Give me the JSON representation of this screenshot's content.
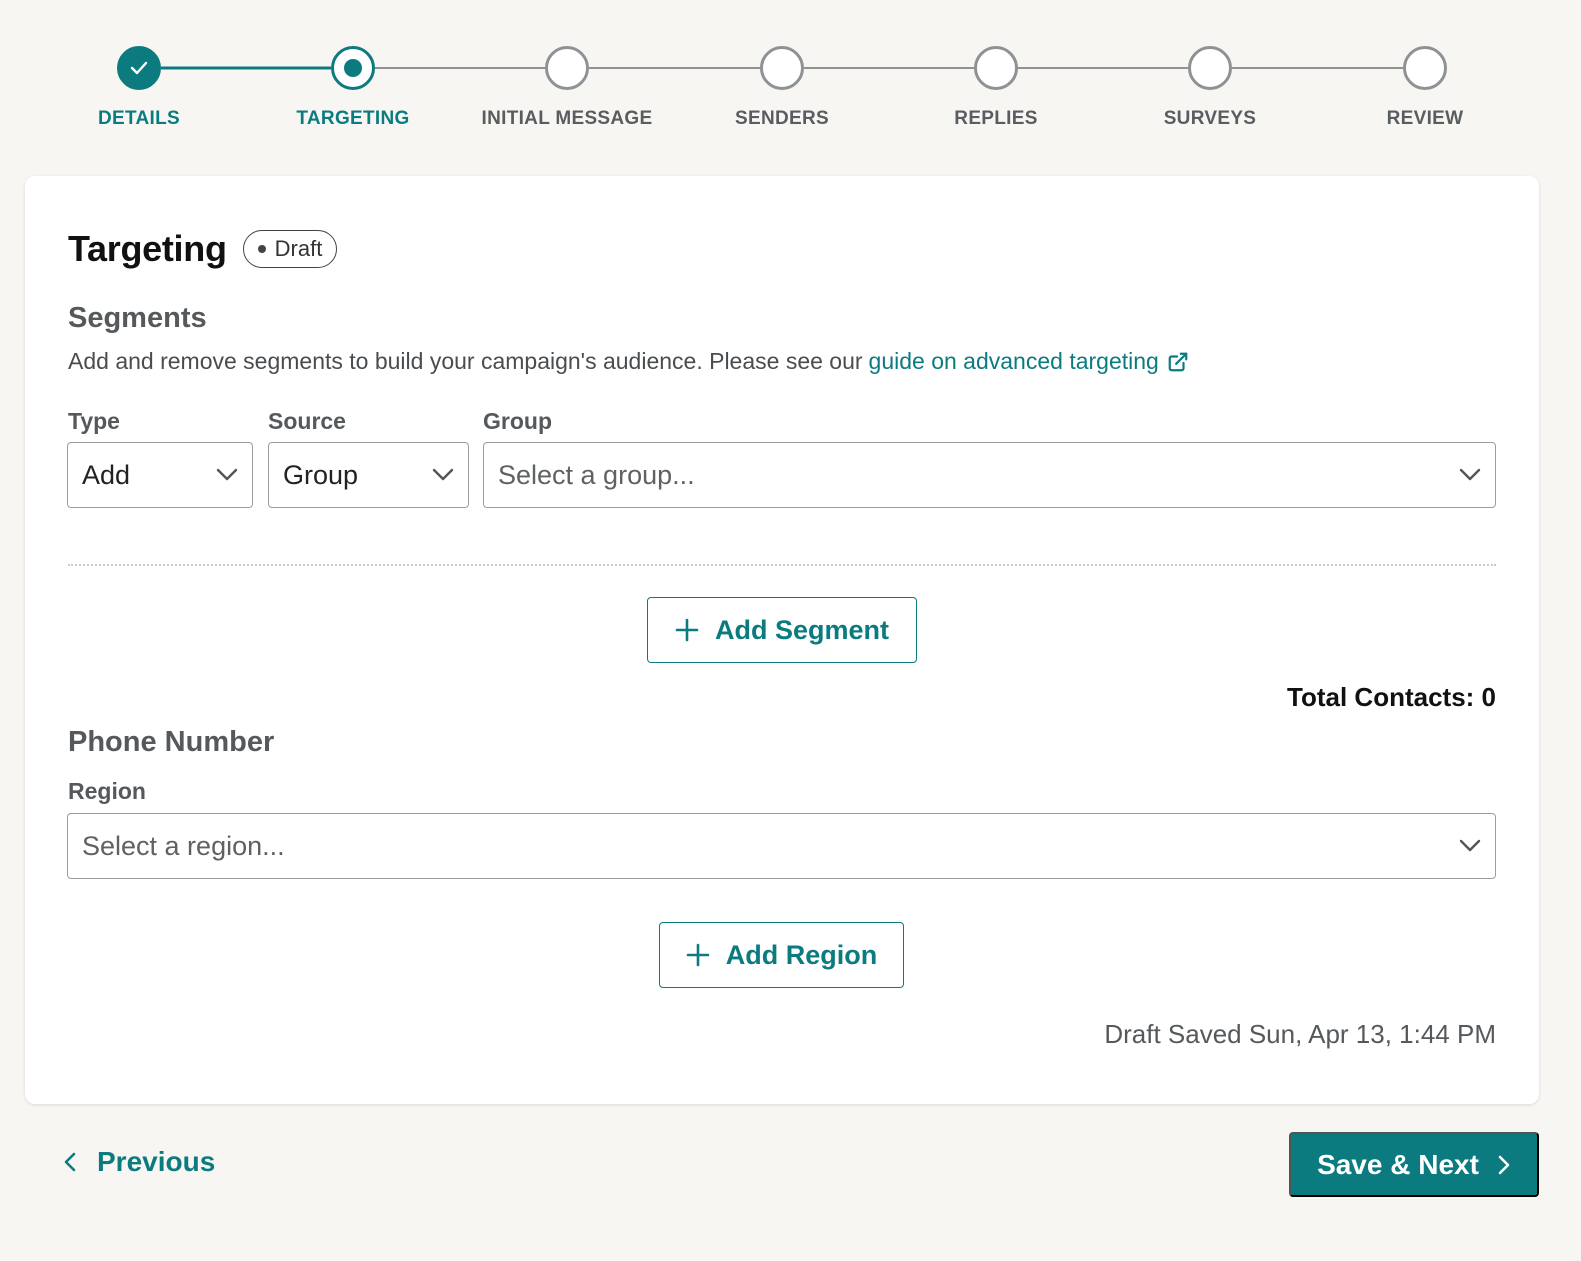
{
  "stepper": {
    "steps": [
      {
        "label": "DETAILS",
        "state": "done"
      },
      {
        "label": "TARGETING",
        "state": "current"
      },
      {
        "label": "INITIAL MESSAGE",
        "state": "todo"
      },
      {
        "label": "SENDERS",
        "state": "todo"
      },
      {
        "label": "REPLIES",
        "state": "todo"
      },
      {
        "label": "SURVEYS",
        "state": "todo"
      },
      {
        "label": "REVIEW",
        "state": "todo"
      }
    ]
  },
  "page": {
    "title": "Targeting",
    "status_badge": "Draft"
  },
  "segments": {
    "title": "Segments",
    "description": "Add and remove segments to build your campaign's audience. Please see our",
    "guide_link": "guide on advanced targeting",
    "type": {
      "label": "Type",
      "value": "Add"
    },
    "source": {
      "label": "Source",
      "value": "Group"
    },
    "group": {
      "label": "Group",
      "placeholder": "Select a group..."
    },
    "add_segment_label": "Add Segment",
    "total_contacts": "Total Contacts: 0"
  },
  "phone_number": {
    "title": "Phone Number",
    "region": {
      "label": "Region",
      "placeholder": "Select a region..."
    },
    "add_region_label": "Add Region"
  },
  "draft_saved": "Draft Saved Sun, Apr 13, 1:44 PM",
  "footer": {
    "previous_label": "Previous",
    "save_next_label": "Save & Next"
  },
  "colors": {
    "accent": "#0c7b80",
    "inactive": "#8f9294",
    "background": "#f7f6f3"
  },
  "icons": [
    "check-icon",
    "external-link-icon",
    "chevron-down-icon",
    "plus-icon",
    "chevron-left-icon",
    "chevron-right-icon"
  ]
}
